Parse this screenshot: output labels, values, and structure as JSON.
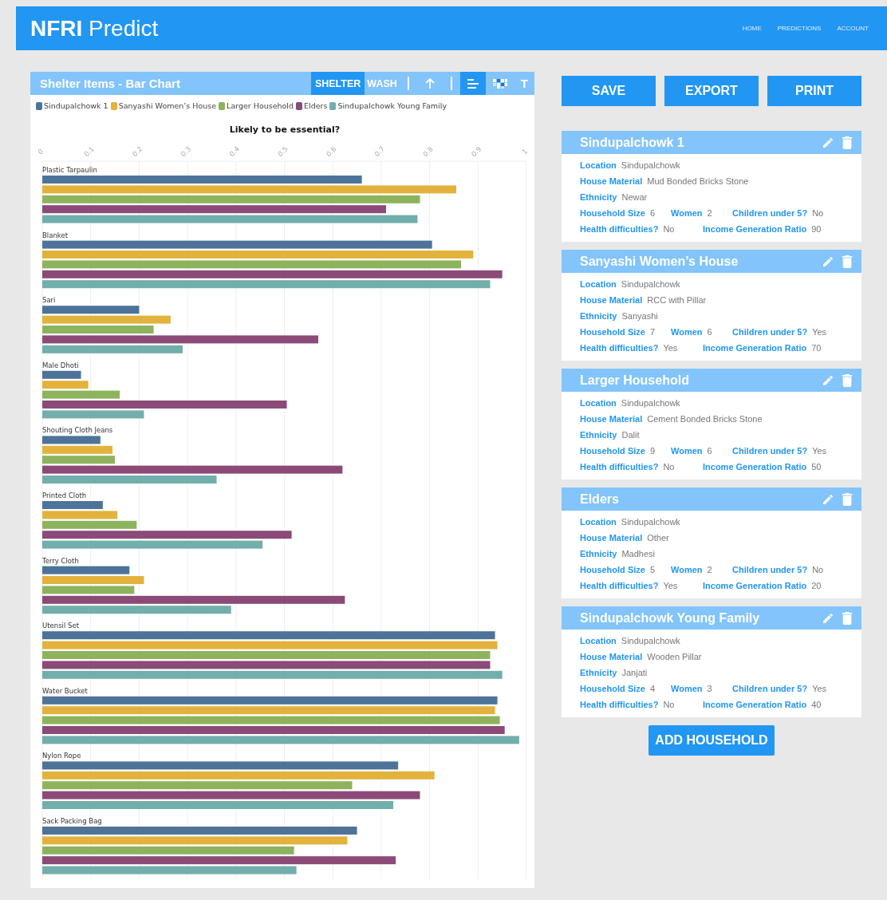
{
  "header": {
    "logo_bold": "NFRI",
    "logo_rest": "Predict",
    "nav": [
      "HOME",
      "PREDICTIONS",
      "ACCOUNT"
    ]
  },
  "chart_panel": {
    "title": "Shelter Items - Bar Chart",
    "tabs": [
      {
        "label": "SHELTER",
        "selected": true
      },
      {
        "label": "WASH",
        "selected": false
      }
    ],
    "tools": [
      {
        "kind": "sort",
        "selected": false
      },
      {
        "kind": "bar",
        "selected": true
      },
      {
        "kind": "heatmap",
        "selected": false
      },
      {
        "kind": "text",
        "label": "T",
        "selected": false
      }
    ],
    "chart_data": {
      "type": "bar",
      "orientation": "horizontal",
      "title": "Likely to be essential?",
      "xlim": [
        0,
        1
      ],
      "grid": true,
      "xticks": [
        0,
        0.1,
        0.2,
        0.3,
        0.4,
        0.5,
        0.6,
        0.7,
        0.8,
        0.9,
        1
      ],
      "categories": [
        "Plastic Tarpaulin",
        "Blanket",
        "Sari",
        "Male Dhoti",
        "Shouting Cloth Jeans",
        "Printed Cloth",
        "Terry Cloth",
        "Utensil Set",
        "Water Bucket",
        "Nylon Rope",
        "Sack Packing Bag"
      ],
      "series": [
        {
          "name": "Sindupalchowk 1",
          "color": "#4e7399",
          "values": [
            0.66,
            0.805,
            0.2,
            0.08,
            0.12,
            0.125,
            0.18,
            0.935,
            0.94,
            0.735,
            0.65
          ]
        },
        {
          "name": "Sanyashi Women’s House",
          "color": "#e3b23c",
          "values": [
            0.855,
            0.89,
            0.265,
            0.095,
            0.145,
            0.155,
            0.21,
            0.94,
            0.935,
            0.81,
            0.63
          ]
        },
        {
          "name": "Larger Household",
          "color": "#8db35d",
          "values": [
            0.78,
            0.865,
            0.23,
            0.16,
            0.15,
            0.195,
            0.19,
            0.925,
            0.945,
            0.64,
            0.52
          ]
        },
        {
          "name": "Elders",
          "color": "#8b4a78",
          "values": [
            0.71,
            0.95,
            0.57,
            0.505,
            0.62,
            0.515,
            0.625,
            0.925,
            0.955,
            0.78,
            0.73
          ]
        },
        {
          "name": "Sindupalchowk Young Family",
          "color": "#72aeab",
          "values": [
            0.775,
            0.925,
            0.29,
            0.21,
            0.36,
            0.455,
            0.39,
            0.95,
            0.985,
            0.725,
            0.525
          ]
        }
      ]
    }
  },
  "actions": [
    "SAVE",
    "EXPORT",
    "PRINT"
  ],
  "households": [
    {
      "name": "Sindupalchowk 1",
      "rows": [
        [
          {
            "label": "Location",
            "value": "Sindupalchowk"
          }
        ],
        [
          {
            "label": "House Material",
            "value": "Mud Bonded Bricks Stone"
          }
        ],
        [
          {
            "label": "Ethnicity",
            "value": "Newar"
          }
        ],
        [
          {
            "label": "Household Size",
            "value": "6"
          },
          {
            "label": "Women",
            "value": "2"
          },
          {
            "label": "Children under 5?",
            "value": "No"
          }
        ],
        [
          {
            "label": "Health difficulties?",
            "value": "No"
          },
          {
            "label": "Income Generation Ratio",
            "value": "90"
          }
        ]
      ]
    },
    {
      "name": "Sanyashi Women’s House",
      "rows": [
        [
          {
            "label": "Location",
            "value": "Sindupalchowk"
          }
        ],
        [
          {
            "label": "House Material",
            "value": "RCC with Pillar"
          }
        ],
        [
          {
            "label": "Ethnicity",
            "value": "Sanyashi"
          }
        ],
        [
          {
            "label": "Household Size",
            "value": "7"
          },
          {
            "label": "Women",
            "value": "6"
          },
          {
            "label": "Children under 5?",
            "value": "Yes"
          }
        ],
        [
          {
            "label": "Health difficulties?",
            "value": "Yes"
          },
          {
            "label": "Income Generation Ratio",
            "value": "70"
          }
        ]
      ]
    },
    {
      "name": "Larger Household",
      "rows": [
        [
          {
            "label": "Location",
            "value": "Sindupalchowk"
          }
        ],
        [
          {
            "label": "House Material",
            "value": "Cement Bonded Bricks Stone"
          }
        ],
        [
          {
            "label": "Ethnicity",
            "value": "Dalit"
          }
        ],
        [
          {
            "label": "Household Size",
            "value": "9"
          },
          {
            "label": "Women",
            "value": "6"
          },
          {
            "label": "Children under 5?",
            "value": "Yes"
          }
        ],
        [
          {
            "label": "Health difficulties?",
            "value": "No"
          },
          {
            "label": "Income Generation Ratio",
            "value": "50"
          }
        ]
      ]
    },
    {
      "name": "Elders",
      "rows": [
        [
          {
            "label": "Location",
            "value": "Sindupalchowk"
          }
        ],
        [
          {
            "label": "House Material",
            "value": "Other"
          }
        ],
        [
          {
            "label": "Ethnicity",
            "value": "Madhesi"
          }
        ],
        [
          {
            "label": "Household Size",
            "value": "5"
          },
          {
            "label": "Women",
            "value": "2"
          },
          {
            "label": "Children under 5?",
            "value": "No"
          }
        ],
        [
          {
            "label": "Health difficulties?",
            "value": "Yes"
          },
          {
            "label": "Income Generation Ratio",
            "value": "20"
          }
        ]
      ]
    },
    {
      "name": "Sindupalchowk Young Family",
      "rows": [
        [
          {
            "label": "Location",
            "value": "Sindupalchowk"
          }
        ],
        [
          {
            "label": "House Material",
            "value": "Wooden Pillar"
          }
        ],
        [
          {
            "label": "Ethnicity",
            "value": "Janjati"
          }
        ],
        [
          {
            "label": "Household Size",
            "value": "4"
          },
          {
            "label": "Women",
            "value": "3"
          },
          {
            "label": "Children under 5?",
            "value": "Yes"
          }
        ],
        [
          {
            "label": "Health difficulties?",
            "value": "No"
          },
          {
            "label": "Income Generation Ratio",
            "value": "40"
          }
        ]
      ]
    }
  ],
  "add_button": "ADD HOUSEHOLD"
}
